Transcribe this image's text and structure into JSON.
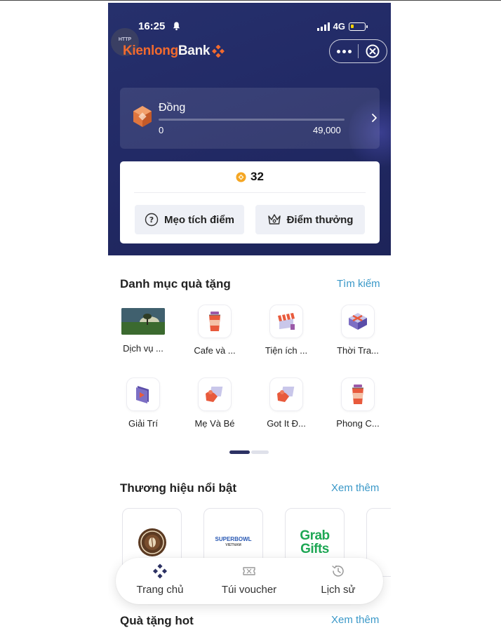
{
  "status_bar": {
    "time": "16:25",
    "network": "4G"
  },
  "header": {
    "http_badge": "HTTP",
    "brand_prefix": "Kienlong",
    "brand_suffix": "Bank"
  },
  "tier": {
    "name": "Đồng",
    "min": "0",
    "max": "49,000",
    "progress": 0
  },
  "points": {
    "value": "32",
    "tips_label": "Mẹo tích điểm",
    "rewards_label": "Điểm thưởng"
  },
  "categories": {
    "title": "Danh mục quà tặng",
    "link": "Tìm kiếm",
    "items": [
      {
        "label": "Dịch vụ ...",
        "icon": "service-photo"
      },
      {
        "label": "Cafe và ...",
        "icon": "coffee-cup-icon"
      },
      {
        "label": "Tiện ích ...",
        "icon": "shop-awning-icon"
      },
      {
        "label": "Thời Tra...",
        "icon": "fashion-box-icon"
      },
      {
        "label": "Giải Trí",
        "icon": "play-icon"
      },
      {
        "label": "Mẹ Và Bé",
        "icon": "gift-hand-icon"
      },
      {
        "label": "Got It Đ...",
        "icon": "gift-hand-icon"
      },
      {
        "label": "Phong C...",
        "icon": "coffee-cup-icon"
      }
    ],
    "page_count": 2,
    "active_page": 1
  },
  "brands": {
    "title": "Thương hiệu nổi bật",
    "link": "Xem thêm",
    "items": [
      {
        "name": "coffee-bean-logo"
      },
      {
        "name": "superbowl-logo",
        "text_main": "SUPERBOWL",
        "text_sub": "VIETNAM"
      },
      {
        "name": "grab-gifts-logo",
        "line1": "Grab",
        "line2": "Gifts"
      }
    ]
  },
  "bottom_nav": {
    "home": "Trang chủ",
    "voucher": "Túi voucher",
    "history": "Lịch sử"
  },
  "hot_gifts": {
    "title": "Quà tặng hot",
    "link": "Xem thêm"
  },
  "colors": {
    "header_bg": "#222a66",
    "brand_orange": "#f26a2e",
    "link_blue": "#3a98c8",
    "grab_green": "#1ea754"
  }
}
